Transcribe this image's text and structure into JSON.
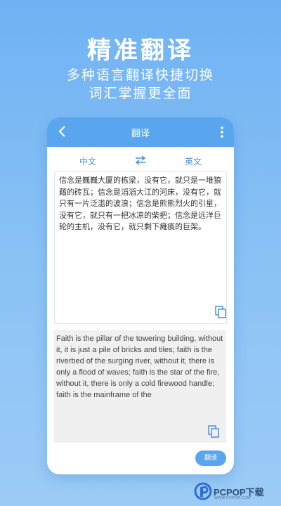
{
  "hero": {
    "title": "精准翻译",
    "subtitle_line1": "多种语言翻译快捷切换",
    "subtitle_line2": "词汇掌握更全面"
  },
  "app": {
    "title": "翻译",
    "source_lang": "中文",
    "target_lang": "英文",
    "source_text": "信念是巍巍大厦的栋梁，没有它，就只是一堆狼藉的砖瓦；信念是滔滔大江的河床，没有它，就只有一片泛滥的波浪；信念是熊熊烈火的引星，没有它，就只有一把冰凉的柴把；信念是远洋巨轮的主机，没有它，就只剩下瘫痪的巨架。",
    "translated_text": "Faith is the pillar of the towering building, without it, it is just a pile of bricks and tiles; faith is the riverbed of the surging river, without it, there is only a flood of waves; faith is the star of the fire, without it, there is only a cold firewood handle; faith is the mainframe of the",
    "translate_button": "翻译"
  },
  "watermark": {
    "brand": "PCPOP下载",
    "subtext": "WWW.PCPOP.COM"
  },
  "colors": {
    "background": "#7db9f4",
    "accent": "#5aa6ee",
    "lang_text": "#4f8fd6"
  },
  "icons": [
    "back-arrow-icon",
    "more-vertical-icon",
    "swap-icon",
    "copy-icon"
  ]
}
